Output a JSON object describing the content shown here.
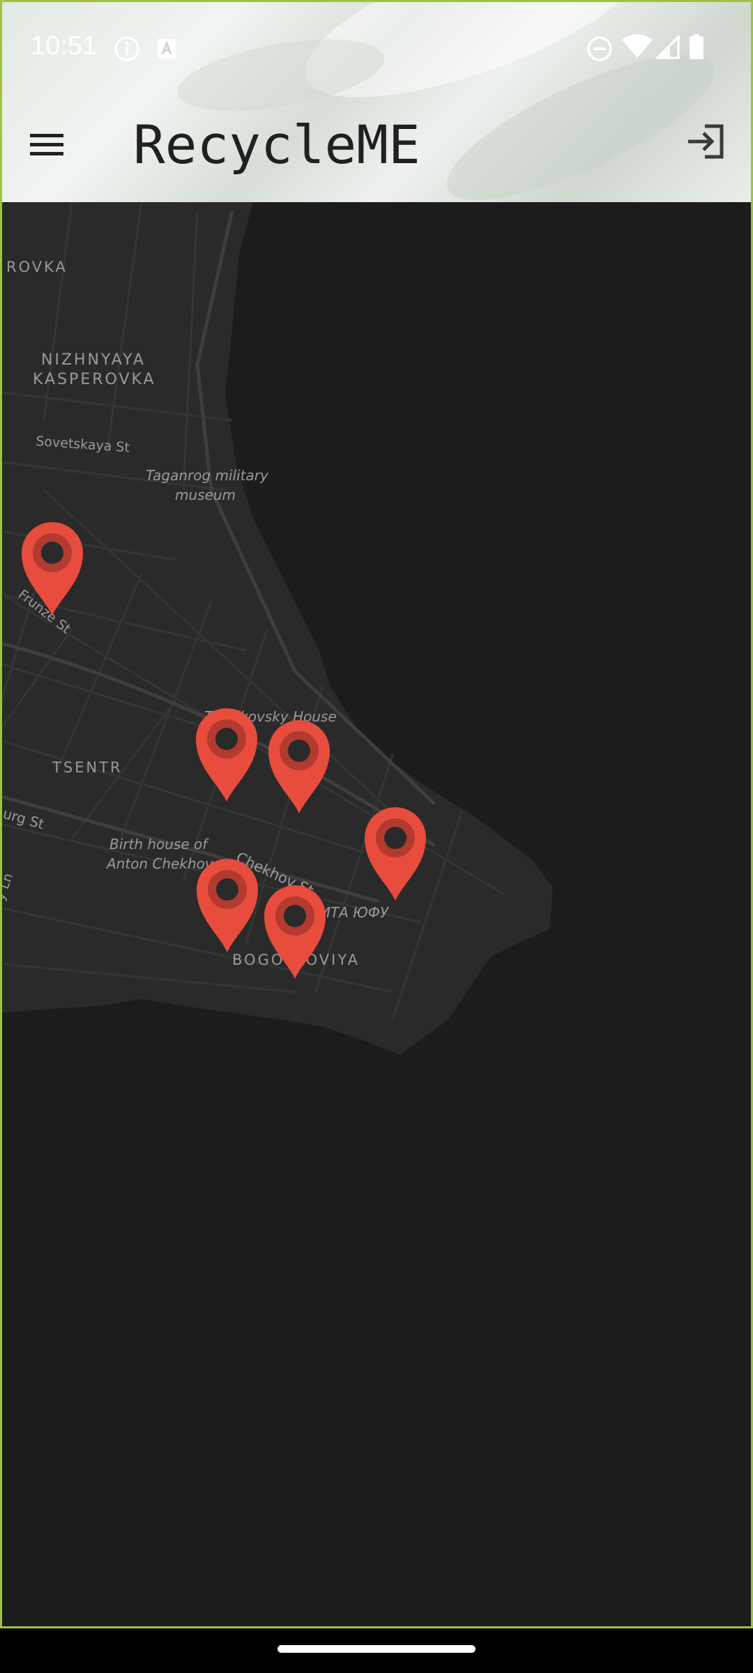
{
  "status_bar": {
    "time": "10:51",
    "left_icons": [
      "info-icon",
      "keyboard-a-icon"
    ],
    "right_icons": [
      "do-not-disturb-icon",
      "wifi-icon",
      "signal-icon",
      "battery-icon"
    ]
  },
  "app_bar": {
    "title": "RecycleME",
    "menu_icon": "hamburger-menu-icon",
    "action_icon": "login-icon"
  },
  "map": {
    "theme": "dark",
    "labels": {
      "rovka": "ROVKA",
      "nizhnyaya": "NIZHNYAYA",
      "kasperovka": "KASPEROVKA",
      "sovetskaya": "Sovetskaya St",
      "military_1": "Taganrog military",
      "military_2": "museum",
      "frunze": "Frunze St",
      "tchaikovsky": "Tchaikovsky House",
      "tsentr": "TSENTR",
      "urg": "urg St",
      "birth_1": "Birth house of",
      "birth_2": "Anton Chekhov",
      "chekhov": "Chekhov St",
      "ita": "ИТА ЮФУ",
      "bogo": "BOGOSLOVIYA",
      "ln": "y Ln"
    },
    "markers": [
      {
        "id": "marker-1",
        "color": "#e84c3d"
      },
      {
        "id": "marker-2",
        "color": "#e84c3d"
      },
      {
        "id": "marker-3",
        "color": "#e84c3d"
      },
      {
        "id": "marker-4",
        "color": "#e84c3d"
      },
      {
        "id": "marker-5",
        "color": "#e84c3d"
      },
      {
        "id": "marker-6",
        "color": "#e84c3d"
      }
    ]
  },
  "colors": {
    "accent_border": "#9cc440",
    "marker": "#e84c3d",
    "map_water": "#1c1c1c",
    "map_land": "#2a2a2a"
  }
}
